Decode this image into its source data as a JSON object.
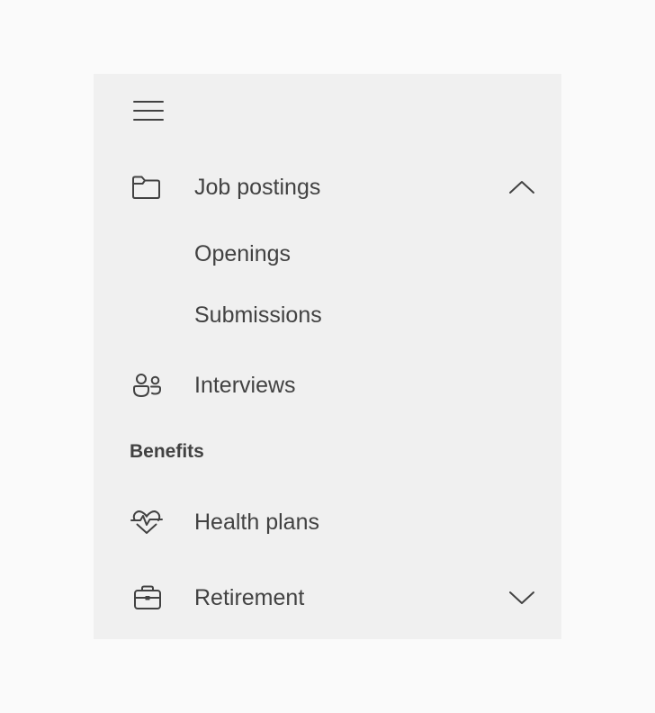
{
  "nav": {
    "menu_icon": "hamburger-icon",
    "items": [
      {
        "label": "Job postings",
        "icon": "folder-icon",
        "expanded": true
      },
      {
        "label": "Openings"
      },
      {
        "label": "Submissions"
      },
      {
        "label": "Interviews",
        "icon": "people-icon"
      }
    ],
    "section_header": "Benefits",
    "benefits_items": [
      {
        "label": "Health plans",
        "icon": "heart-pulse-icon"
      },
      {
        "label": "Retirement",
        "icon": "briefcase-icon",
        "expanded": false
      }
    ]
  },
  "colors": {
    "page_background": "#fafafa",
    "panel_background": "#f0f0f0",
    "text": "#424242"
  }
}
